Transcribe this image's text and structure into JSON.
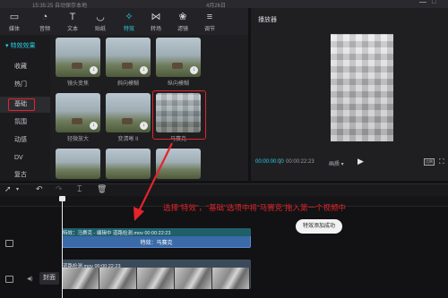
{
  "topbar": {
    "status": "15:35:25 自动保存本地",
    "date": "4月26日"
  },
  "tools": [
    {
      "label": "媒体",
      "icon": "▭",
      "name": "media"
    },
    {
      "label": "音频",
      "icon": "◔",
      "name": "audio"
    },
    {
      "label": "文本",
      "icon": "T",
      "name": "text"
    },
    {
      "label": "贴纸",
      "icon": "◡",
      "name": "sticker"
    },
    {
      "label": "特效",
      "icon": "✧",
      "name": "effects"
    },
    {
      "label": "转场",
      "icon": "⋈",
      "name": "transition"
    },
    {
      "label": "滤镜",
      "icon": "❀",
      "name": "filter"
    },
    {
      "label": "调节",
      "icon": "≡",
      "name": "adjust"
    }
  ],
  "sidebar": {
    "header": "▾ 特效效果",
    "items": [
      "收藏",
      "热门",
      "基础",
      "氛围",
      "动感",
      "DV",
      "复古"
    ]
  },
  "tiles": [
    {
      "caption": "镜头变焦"
    },
    {
      "caption": "斜向模糊"
    },
    {
      "caption": "纵向模糊"
    },
    {
      "caption": "轻微放大"
    },
    {
      "caption": "变清晰 II"
    },
    {
      "caption": "马赛克"
    },
    {
      "caption": ""
    },
    {
      "caption": ""
    },
    {
      "caption": ""
    }
  ],
  "player": {
    "title": "播放器",
    "time_current": "00:00:00:00",
    "time_total": "00:00:22:23",
    "quality": "画质 ▾",
    "ratio": "比例"
  },
  "timeline": {
    "annotation": "选择“特效”，“基础”选项中将“马赛克”拖入第一个视频中",
    "toast": "特效添加成功",
    "effect_head": "特效：马赛克 - 编辑中   道路检测.mov   00:00:22:23",
    "effect_label": "特效：马赛克",
    "video_head": "道路检测.mov   00:00:22:23",
    "cover": "封面"
  },
  "colors": {
    "accent": "#2ad0e8",
    "highlight": "#e3242b",
    "effect_track": "#3a6aa8"
  }
}
